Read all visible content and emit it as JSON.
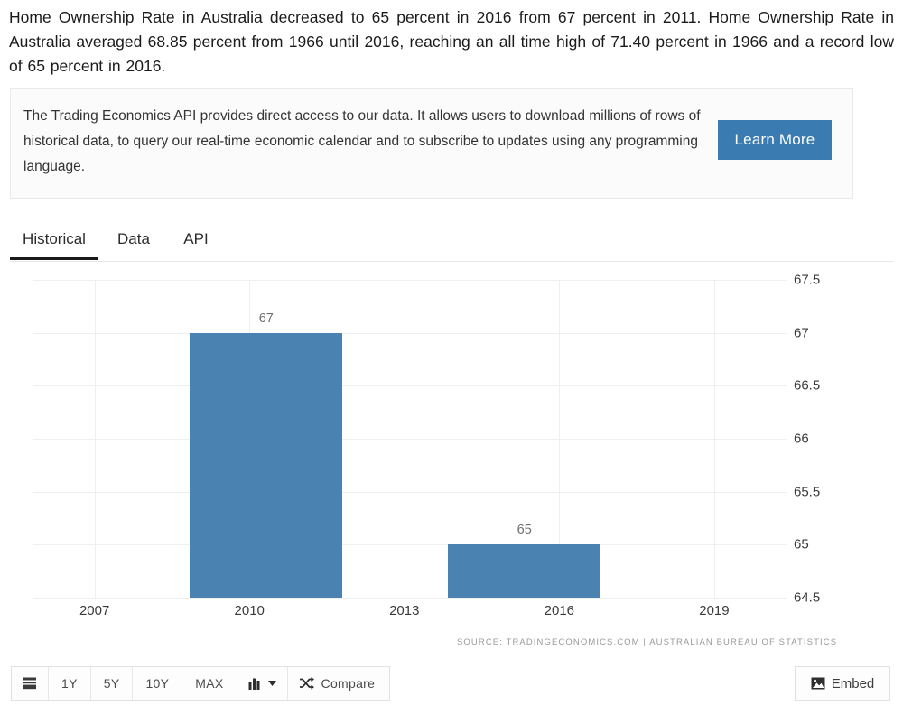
{
  "intro": {
    "text": "Home Ownership Rate in Australia decreased to 65 percent in 2016 from 67 percent in 2011. Home Ownership Rate in Australia averaged 68.85 percent from 1966 until 2016, reaching an all time high of 71.40 percent in 1966 and a record low of 65 percent in 2016."
  },
  "api_box": {
    "text": "The Trading Economics API provides direct access to our data. It allows users to download millions of rows of historical data, to query our real-time economic calendar and to subscribe to updates using any programming language.",
    "button_label": "Learn More",
    "button_color": "#3a7cb1"
  },
  "tabs": [
    {
      "label": "Historical",
      "active": true
    },
    {
      "label": "Data",
      "active": false
    },
    {
      "label": "API",
      "active": false
    }
  ],
  "chart_data": {
    "type": "bar",
    "title": "",
    "subtitle": "",
    "xlabel": "",
    "ylabel": "",
    "categories": [
      "2011",
      "2016"
    ],
    "values": [
      67,
      65
    ],
    "data_labels": [
      "67",
      "65"
    ],
    "ylim": [
      64.5,
      67.5
    ],
    "yticks": [
      "67.5",
      "67",
      "66.5",
      "66",
      "65.5",
      "65",
      "64.5"
    ],
    "ytick_values": [
      67.5,
      67,
      66.5,
      66,
      65.5,
      65,
      64.5
    ],
    "xticks": [
      "2007",
      "2010",
      "2013",
      "2016",
      "2019"
    ],
    "xtick_values": [
      2007,
      2010,
      2013,
      2016,
      2019
    ],
    "xlim": [
      2005.8,
      2020.4
    ],
    "grid": true,
    "legend": false,
    "bar_color": "#4a82b1",
    "source": "SOURCE: TRADINGECONOMICS.COM  |  AUSTRALIAN BUREAU OF STATISTICS"
  },
  "toolbar": {
    "range_buttons": [
      "1Y",
      "5Y",
      "10Y",
      "MAX"
    ],
    "compare_label": "Compare",
    "embed_label": "Embed"
  }
}
